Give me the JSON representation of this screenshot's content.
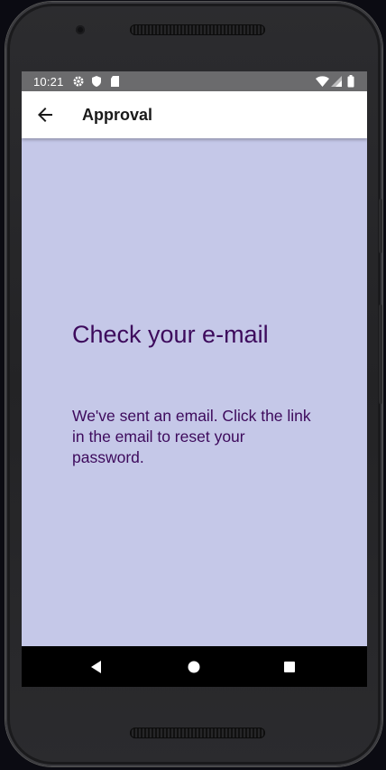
{
  "status_bar": {
    "time": "10:21",
    "left_icons": [
      "gear-icon",
      "shield-icon",
      "sd-card-icon"
    ],
    "right_icons": [
      "wifi-icon",
      "signal-icon",
      "battery-icon"
    ]
  },
  "app_bar": {
    "title": "Approval",
    "back_icon": "arrow-back-icon"
  },
  "content": {
    "heading": "Check your e-mail",
    "message": "We've sent an email. Click the link in the email to reset your password."
  },
  "nav_bar": {
    "buttons": [
      "back-triangle-icon",
      "home-circle-icon",
      "recents-square-icon"
    ]
  },
  "colors": {
    "background": "#c5c8e8",
    "text": "#3d0a5c",
    "status_bar": "#6b6b6d",
    "app_bar": "#ffffff",
    "nav_bar": "#000000"
  }
}
